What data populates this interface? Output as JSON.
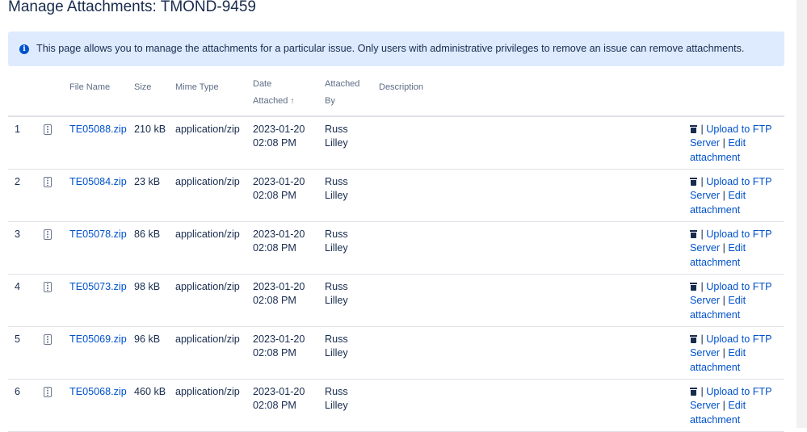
{
  "page": {
    "title": "Manage Attachments: TMOND-9459",
    "info_icon": "info-icon",
    "info_text": "This page allows you to manage the attachments for a particular issue. Only users with administrative privileges to remove an issue can remove attachments."
  },
  "table": {
    "headers": {
      "file_name": "File Name",
      "size": "Size",
      "mime_type": "Mime Type",
      "date_line1": "Date",
      "date_line2": "Attached",
      "date_sort_icon": "↑",
      "by_line1": "Attached",
      "by_line2": "By",
      "description": "Description"
    },
    "rows": [
      {
        "index": "1",
        "file_name": "TE05088.zip",
        "size": "210 kB",
        "mime": "application/zip",
        "date": "2023-01-20",
        "time": "02:08 PM",
        "by_first": "Russ",
        "by_last": "Lilley",
        "description": "",
        "action_sep1": "|",
        "action_upload": "Upload to FTP Server",
        "action_sep2": "|",
        "action_edit": "Edit attachment"
      },
      {
        "index": "2",
        "file_name": "TE05084.zip",
        "size": "23 kB",
        "mime": "application/zip",
        "date": "2023-01-20",
        "time": "02:08 PM",
        "by_first": "Russ",
        "by_last": "Lilley",
        "description": "",
        "action_sep1": "|",
        "action_upload": "Upload to FTP Server",
        "action_sep2": "|",
        "action_edit": "Edit attachment"
      },
      {
        "index": "3",
        "file_name": "TE05078.zip",
        "size": "86 kB",
        "mime": "application/zip",
        "date": "2023-01-20",
        "time": "02:08 PM",
        "by_first": "Russ",
        "by_last": "Lilley",
        "description": "",
        "action_sep1": "|",
        "action_upload": "Upload to FTP Server",
        "action_sep2": "|",
        "action_edit": "Edit attachment"
      },
      {
        "index": "4",
        "file_name": "TE05073.zip",
        "size": "98 kB",
        "mime": "application/zip",
        "date": "2023-01-20",
        "time": "02:08 PM",
        "by_first": "Russ",
        "by_last": "Lilley",
        "description": "",
        "action_sep1": "|",
        "action_upload": "Upload to FTP Server",
        "action_sep2": "|",
        "action_edit": "Edit attachment"
      },
      {
        "index": "5",
        "file_name": "TE05069.zip",
        "size": "96 kB",
        "mime": "application/zip",
        "date": "2023-01-20",
        "time": "02:08 PM",
        "by_first": "Russ",
        "by_last": "Lilley",
        "description": "",
        "action_sep1": "|",
        "action_upload": "Upload to FTP Server",
        "action_sep2": "|",
        "action_edit": "Edit attachment"
      },
      {
        "index": "6",
        "file_name": "TE05068.zip",
        "size": "460 kB",
        "mime": "application/zip",
        "date": "2023-01-20",
        "time": "02:08 PM",
        "by_first": "Russ",
        "by_last": "Lilley",
        "description": "",
        "action_sep1": "|",
        "action_upload": "Upload to FTP Server",
        "action_sep2": "|",
        "action_edit": "Edit attachment"
      }
    ]
  },
  "icons": {
    "file": "zip-file-icon",
    "delete": "trash-icon"
  },
  "colors": {
    "link": "#0052cc",
    "text": "#172b4d",
    "info_bg": "#deebff",
    "header_text": "#5e6c84"
  }
}
